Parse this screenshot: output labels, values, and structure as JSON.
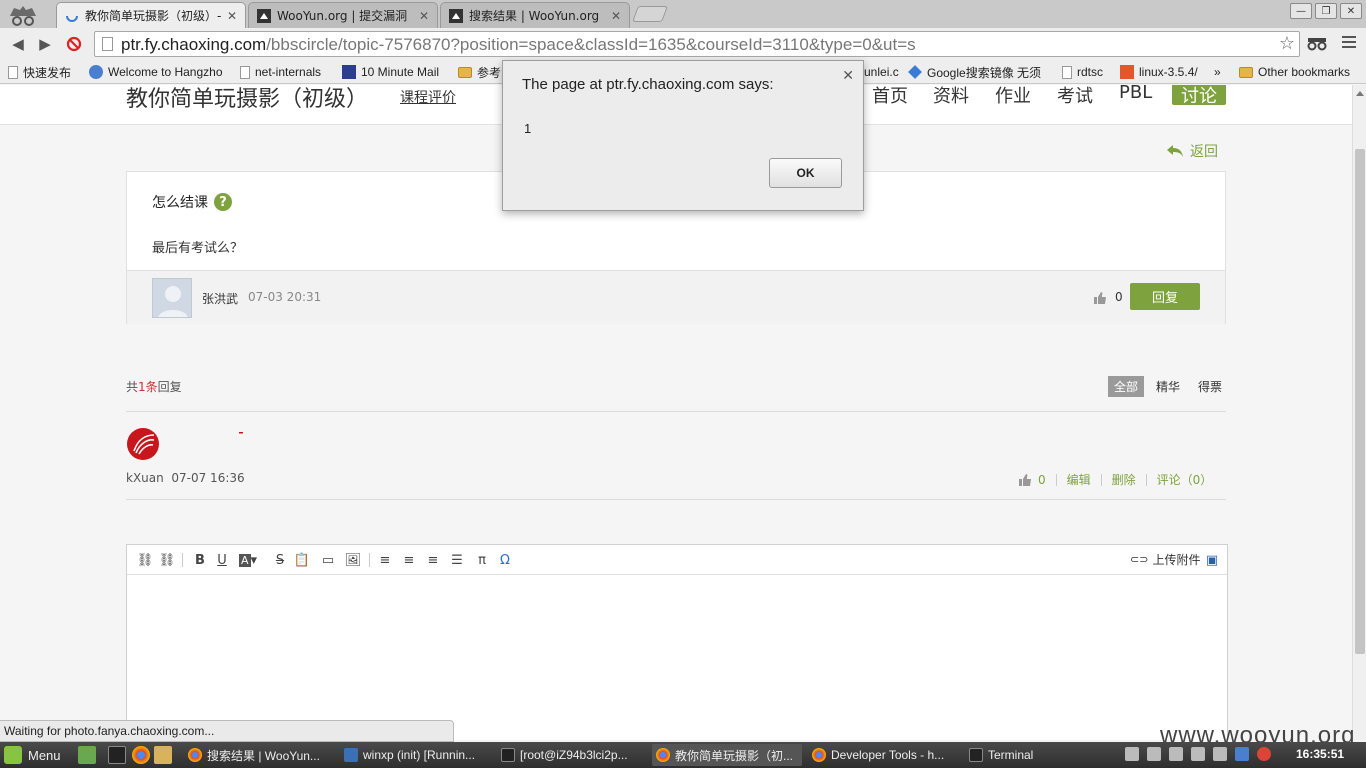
{
  "browser": {
    "tabs": [
      {
        "label": "教你简单玩摄影（初级）-",
        "active": true
      },
      {
        "label": "WooYun.org | 提交漏洞",
        "active": false
      },
      {
        "label": "搜索结果 | WooYun.org",
        "active": false
      }
    ],
    "url_host": "ptr.fy.chaoxing.com",
    "url_path": "/bbscircle/topic-7576870?position=space&classId=1635&courseId=3110&type=0&ut=s",
    "bookmarks": [
      "快速发布",
      "Welcome to Hangzho",
      "net-internals",
      "10 Minute Mail",
      "参考",
      "unlei.c",
      "Google搜索镜像 无须",
      "rdtsc",
      "linux-3.5.4/",
      "»",
      "Other bookmarks"
    ],
    "status": "Waiting for photo.fanya.chaoxing.com..."
  },
  "page": {
    "course_title": "教你简单玩摄影（初级）",
    "course_eval": "课程评价",
    "nav": [
      "首页",
      "资料",
      "作业",
      "考试",
      "PBL",
      "讨论"
    ],
    "back": "返回",
    "topic": {
      "title": "怎么结课",
      "body": "最后有考试么？",
      "author": "张洪武",
      "time": "07-03 20:31",
      "likes": "0",
      "reply_button": "回复"
    },
    "reply_count": {
      "prefix": "共",
      "num": "1条",
      "suffix": "回复"
    },
    "filters": [
      "全部",
      "精华",
      "得票"
    ],
    "reply": {
      "user": "kXuan",
      "time": "07-07 16:36",
      "likes": "0",
      "edit": "编辑",
      "delete": "删除",
      "comment": "评论（0）"
    },
    "editor": {
      "upload": "上传附件"
    }
  },
  "dialog": {
    "title": "The page at ptr.fy.chaoxing.com says:",
    "message": "1",
    "ok": "OK"
  },
  "watermark": "www.wooyun.org",
  "taskbar": {
    "menu": "Menu",
    "tasks": [
      "搜索结果 | WooYun...",
      "winxp (init) [Runnin...",
      "[root@iZ94b3lci2p...",
      "教你简单玩摄影（初...",
      "Developer Tools - h...",
      "Terminal"
    ],
    "clock": "16:35:51"
  },
  "colors": {
    "accent": "#7ea23e",
    "danger": "#d03030"
  }
}
